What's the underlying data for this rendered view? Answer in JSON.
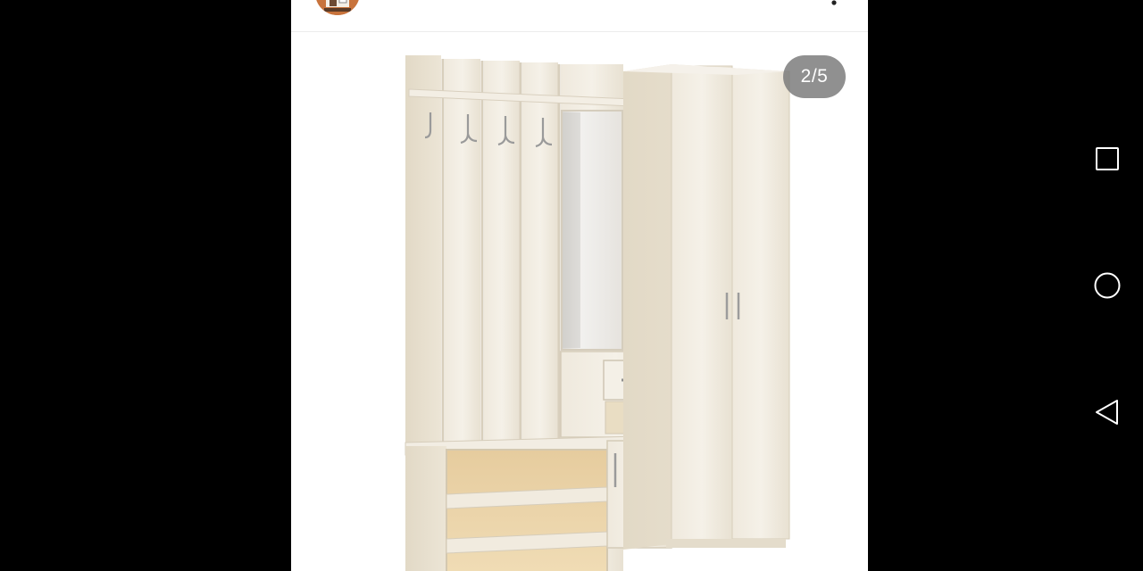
{
  "post": {
    "avatar_icon": "store-avatar-icon",
    "more_icon": "more-vertical-icon"
  },
  "photo": {
    "subject_icon": "hallway-furniture-photo",
    "counter": "2/5",
    "current": 2,
    "total": 5
  },
  "navigation": {
    "recents_icon": "square-icon",
    "home_icon": "circle-icon",
    "back_icon": "triangle-back-icon"
  },
  "colors": {
    "background": "#000000",
    "panel": "#ffffff",
    "badge": "#787878",
    "wood": "#ede7da",
    "nav_icon": "#ffffff"
  }
}
